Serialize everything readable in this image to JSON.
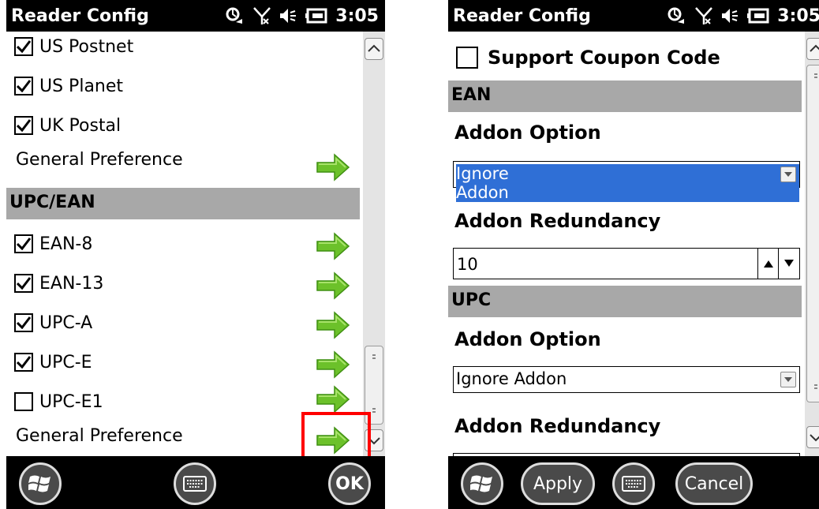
{
  "left": {
    "status": {
      "title": "Reader Config",
      "time": "3:05"
    },
    "symbologies": [
      {
        "label": "US Postnet",
        "checked": true
      },
      {
        "label": "US Planet",
        "checked": true
      },
      {
        "label": "UK Postal",
        "checked": true
      }
    ],
    "general_pref_1": "General Preference",
    "section": "UPC/EAN",
    "upc_items": [
      {
        "label": "EAN-8",
        "checked": true
      },
      {
        "label": "EAN-13",
        "checked": true
      },
      {
        "label": "UPC-A",
        "checked": true
      },
      {
        "label": "UPC-E",
        "checked": true
      },
      {
        "label": "UPC-E1",
        "checked": false
      }
    ],
    "general_pref_2": "General Preference",
    "softkeys": {
      "ok": "OK"
    }
  },
  "right": {
    "status": {
      "title": "Reader Config",
      "time": "3:05"
    },
    "support_coupon": {
      "label": "Support Coupon Code",
      "checked": false
    },
    "ean_section": "EAN",
    "ean_addon_option_label": "Addon Option",
    "ean_addon_option_value": "Ignore Addon",
    "ean_addon_redundancy_label": "Addon Redundancy",
    "ean_addon_redundancy_value": "10",
    "upc_section": "UPC",
    "upc_addon_option_label": "Addon Option",
    "upc_addon_option_value": "Ignore Addon",
    "upc_addon_redundancy_label": "Addon Redundancy",
    "softkeys": {
      "apply": "Apply",
      "cancel": "Cancel"
    }
  },
  "colors": {
    "arrow_green": "#6cc12a",
    "section_gray": "#a8a8a8",
    "selection_blue": "#2f6fd6",
    "highlight_red": "#ff0000"
  }
}
